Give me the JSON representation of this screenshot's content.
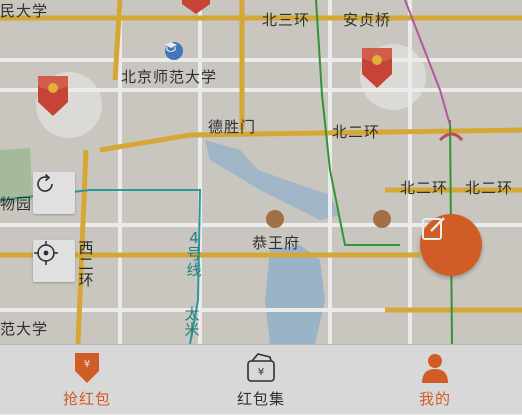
{
  "map": {
    "labels": {
      "min_university": "民大学",
      "north_third_ring": "北三环",
      "anzhen_bridge": "安贞桥",
      "bnu": "北京师范大学",
      "deshengmen": "德胜门",
      "north_second_ring_1": "北二环",
      "north_second_ring_2": "北二环",
      "north_second_ring_3": "北二环",
      "wu_garden": "物园",
      "prince_gong_mansion": "恭王府",
      "fan_university": "范大学",
      "west_second_ring": "西二环",
      "line4": "4号线",
      "line_taixi": "太米",
      "hao": "号线"
    }
  },
  "tabs": {
    "grab": {
      "label": "抢红包",
      "color": "#e2652a"
    },
    "collection": {
      "label": "红包集",
      "color": "#333333"
    },
    "mine": {
      "label": "我的",
      "color": "#e2652a"
    }
  },
  "colors": {
    "accent": "#e2652a",
    "marker_red": "#d64a3a",
    "road_yellow": "#e8b63a"
  }
}
